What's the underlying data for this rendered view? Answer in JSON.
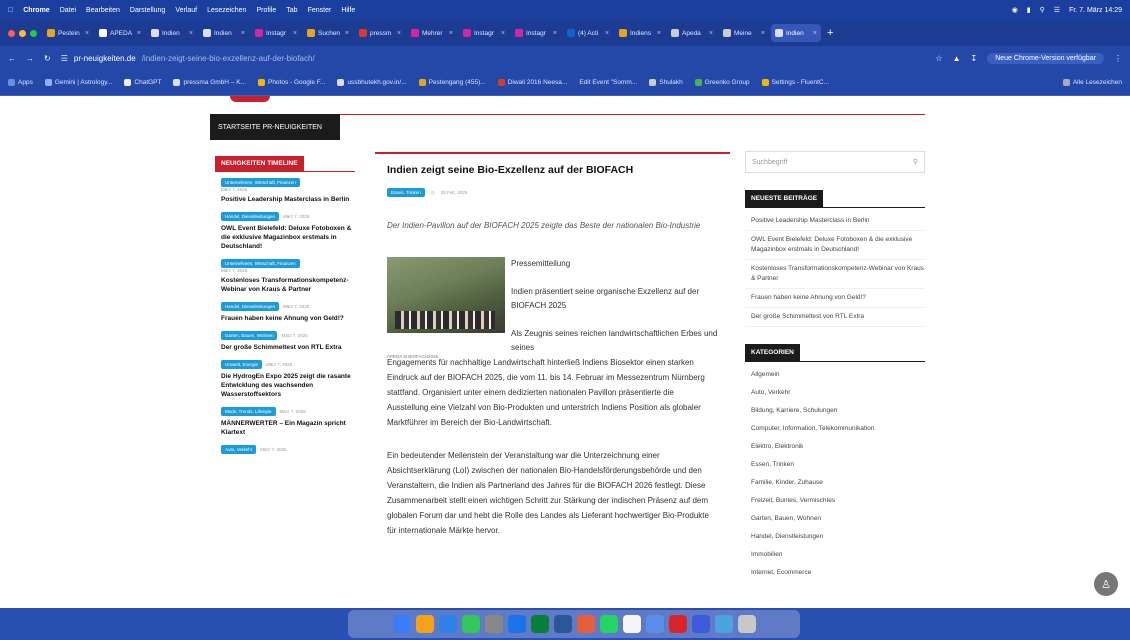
{
  "menubar": {
    "app": "Chrome",
    "items": [
      "Datei",
      "Bearbeiten",
      "Darstellung",
      "Verlauf",
      "Lesezeichen",
      "Profile",
      "Tab",
      "Fenster",
      "Hilfe"
    ],
    "datetime": "Fr. 7. März 14:29"
  },
  "tabs": [
    {
      "label": "Pestein"
    },
    {
      "label": "APEDA"
    },
    {
      "label": "Indien"
    },
    {
      "label": "Indien"
    },
    {
      "label": "Instagr"
    },
    {
      "label": "Suchen"
    },
    {
      "label": "pressm"
    },
    {
      "label": "Mehrer"
    },
    {
      "label": "Instagr"
    },
    {
      "label": "Instagr"
    },
    {
      "label": "(4) Acti"
    },
    {
      "label": "Indiens"
    },
    {
      "label": "Apeda"
    },
    {
      "label": "Meine"
    },
    {
      "label": "Indien"
    }
  ],
  "address": {
    "domain": "pr-neuigkeiten.de",
    "path": "/indien-zeigt-seine-bio-exzellenz-auf-der-biofach/",
    "update": "Neue Chrome-Version verfügbar"
  },
  "bookmarks": [
    "Apps",
    "Gemini | Astrology...",
    "ChatGPT",
    "pressma GmbH – K...",
    "Photos - Google F...",
    "ussbhutekh.gov.in/...",
    "Pestengang (455)...",
    "Diwali 2016 Neesa...",
    "Edit Event \"Somm...",
    "Shulakh",
    "Greenko Group",
    "Settings - FluentC...",
    "Alle Lesezeichen"
  ],
  "nav": {
    "home": "STARTSEITE PR-NEUIGKEITEN"
  },
  "timeline": {
    "heading": "NEUIGKEITEN TIMELINE",
    "items": [
      {
        "category": "Unternehmen, Wirtschaft, Finanzen",
        "date": "März 7, 2025",
        "title": "Positive Leadership Masterclass in Berlin"
      },
      {
        "category": "Handel, Dienstleistungen",
        "date": "März 7, 2025",
        "title": "OWL Event Bielefeld: Deluxe Fotoboxen & die exklusive Magazinbox erstmals in Deutschland!"
      },
      {
        "category": "Unternehmen, Wirtschaft, Finanzen",
        "date": "März 7, 2025",
        "title": "Kostenloses Transformationskompetenz-Webinar von Kraus & Partner"
      },
      {
        "category": "Handel, Dienstleistungen",
        "date": "März 7, 2025",
        "title": "Frauen haben keine Ahnung von Geld!?"
      },
      {
        "category": "Garten, Bauen, Wohnen",
        "date": "März 7, 2025",
        "title": "Der große Schimmeltest von RTL Extra"
      },
      {
        "category": "Umwelt, Energie",
        "date": "März 7, 2025",
        "title": "Die HydrogEn Expo 2025 zeigt die rasante Entwicklung des wachsenden Wasserstoffsektors"
      },
      {
        "category": "Mode, Trends, Lifestyle",
        "date": "März 7, 2025",
        "title": "MÄNNERWERTER – Ein Magazin spricht Klartext"
      },
      {
        "category": "Auto, Verkehr",
        "date": "März 7, 2025",
        "title": ""
      }
    ]
  },
  "article": {
    "title": "Indien zeigt seine Bio-Exzellenz auf der BIOFACH",
    "category": "Essen, Trinken",
    "date": "25 Feb, 2025",
    "lead": "Der Indien-Pavillon auf der BIOFACH 2025 zeigte das Beste der nationalen Bio-Industrie",
    "caption": "APEDA at BIOFACH2025",
    "side1": "Pressemitteilung",
    "side2": "Indien präsentiert seine organische Exzellenz auf der BIOFACH 2025",
    "side3": "Als Zeugnis seines reichen landwirtschaftlichen Erbes und seines",
    "para1": "Engagements für nachhaltige Landwirtschaft hinterließ Indiens Biosektor einen starken Eindruck auf der BIOFACH 2025, die vom 11. bis 14. Februar im Messezentrum Nürnberg stattfand. Organisiert unter einem dedizierten nationalen Pavillon präsentierte die Ausstellung eine Vielzahl von Bio-Produkten und unterstrich Indiens Position als globaler Marktführer im Bereich der Bio-Landwirtschaft.",
    "para2": "Ein bedeutender Meilenstein der Veranstaltung war die Unterzeichnung einer Absichtserklärung (LoI) zwischen der nationalen Bio-Handelsförderungsbehörde und den Veranstaltern, die Indien als Partnerland des Jahres für die BIOFACH 2026 festlegt. Diese Zusammenarbeit stellt einen wichtigen Schritt zur Stärkung der indischen Präsenz auf dem globalen Forum dar und hebt die Rolle des Landes als Lieferant hochwertiger Bio-Produkte für internationale Märkte hervor."
  },
  "sidebar": {
    "search_placeholder": "Suchbegriff",
    "recent_heading": "NEUESTE BEITRÄGE",
    "recent": [
      "Positive Leadership Masterclass in Berlin",
      "OWL Event Bielefeld: Deluxe Fotoboxen & die exklusive Magazinbox erstmals in Deutschland!",
      "Kostenloses Transformationskompetenz-Webinar von Kraus & Partner",
      "Frauen haben keine Ahnung von Geld!?",
      "Der große Schimmeltest von RTL Extra"
    ],
    "categories_heading": "KATEGORIEN",
    "categories": [
      "Allgemein",
      "Auto, Verkehr",
      "Bildung, Karriere, Schulungen",
      "Computer, Information, Telekommunikation",
      "Elektro, Elektronik",
      "Essen, Trinken",
      "Familie, Kinder, Zuhause",
      "Freizeit, Buntes, Vermischtes",
      "Garten, Bauen, Wohnen",
      "Handel, Dienstleistungen",
      "Immobilien",
      "Internet, Ecommerce"
    ]
  },
  "colors": {
    "accent": "#c9202e",
    "pill": "#1d9bd9",
    "chrome": "#1c3c93"
  }
}
